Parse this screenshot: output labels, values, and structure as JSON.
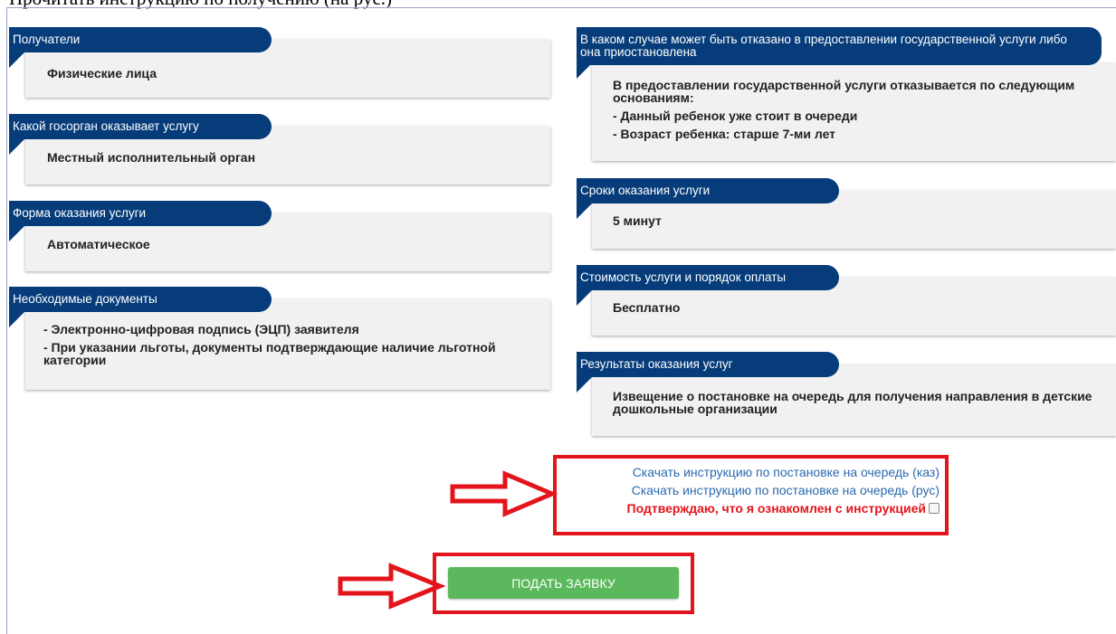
{
  "top_text": "Прочитать инструкцию по получению (на рус.)",
  "cards_left": [
    {
      "header": "Получатели",
      "lines": [
        "Физические лица"
      ]
    },
    {
      "header": "Какой госорган оказывает услугу",
      "lines": [
        "Местный исполнительный орган"
      ]
    },
    {
      "header": "Форма оказания услуги",
      "lines": [
        "Автоматическое"
      ]
    },
    {
      "header": "Необходимые документы",
      "lines": [
        "- Электронно-цифровая подпись (ЭЦП) заявителя",
        "- При указании льготы, документы подтверждающие наличие льготной категории"
      ]
    }
  ],
  "cards_right": [
    {
      "header": "В каком случае может быть отказано в предоставлении государственной услуги либо она приостановлена",
      "lines": [
        "В предоставлении государственной услуги отказывается по следующим основаниям:",
        "- Данный ребенок уже стоит в очереди",
        "- Возраст ребенка: старше 7-ми лет"
      ]
    },
    {
      "header": "Сроки оказания услуги",
      "lines": [
        "5 минут"
      ]
    },
    {
      "header": "Стоимость услуги и порядок оплаты",
      "lines": [
        "Бесплатно"
      ]
    },
    {
      "header": "Результаты оказания услуг",
      "lines": [
        "Извещение о постановке на очередь для получения направления в детские дошкольные организации"
      ]
    }
  ],
  "links": {
    "kaz": "Скачать инструкцию по постановке на очередь (каз)",
    "rus": "Скачать инструкцию по постановке на очередь (рус)",
    "confirm": "Подтверждаю, что я ознакомлен с инструкцией",
    "confirm_checked": false
  },
  "submit_label": "ПОДАТЬ ЗАЯВКУ",
  "colors": {
    "header_bg": "#063c7a",
    "card_bg": "#f1f1f1",
    "link": "#2a6ab0",
    "highlight": "#e3141b",
    "submit_bg": "#5cb85c"
  }
}
